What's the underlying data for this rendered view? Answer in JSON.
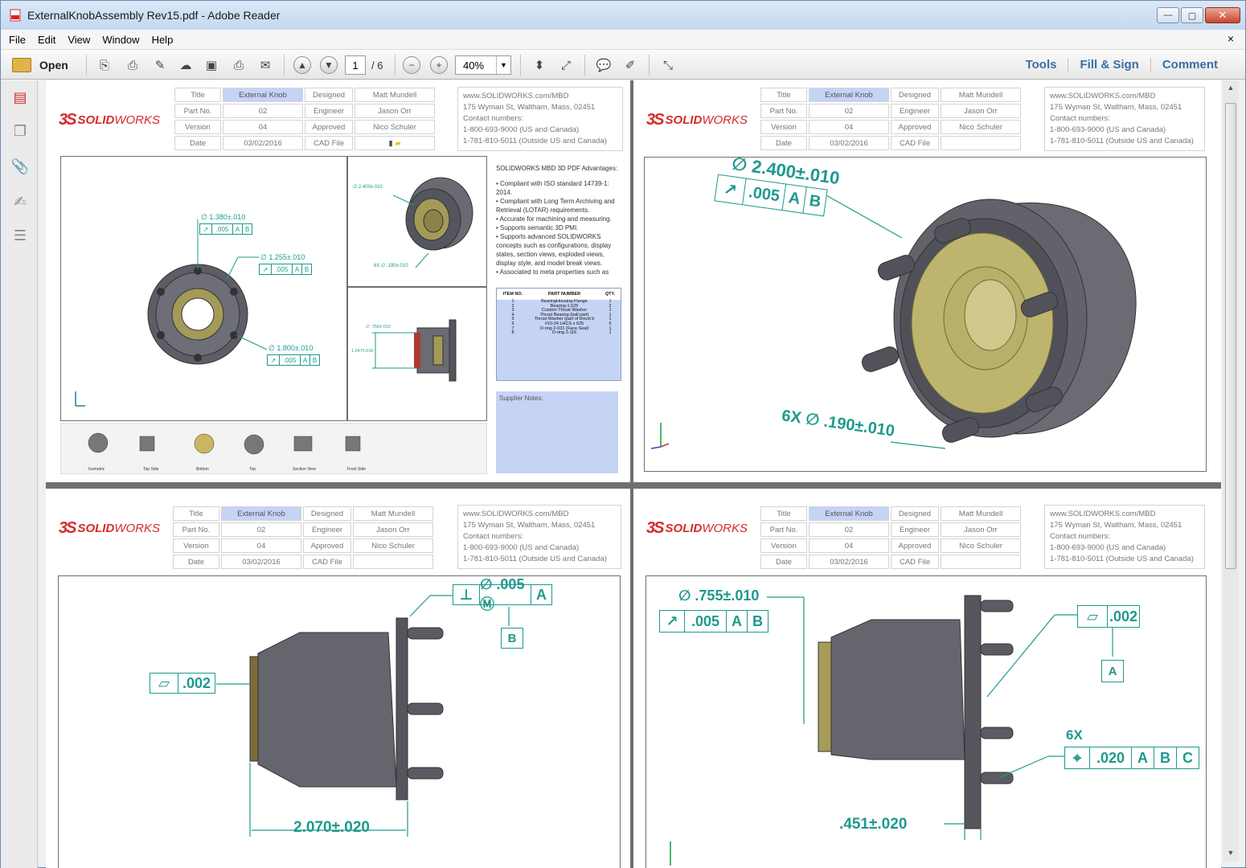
{
  "window": {
    "title": "ExternalKnobAssembly Rev15.pdf - Adobe Reader",
    "controls": {
      "minimize": "—",
      "maximize": "▢",
      "close": "✕"
    }
  },
  "menu": {
    "items": [
      "File",
      "Edit",
      "View",
      "Window",
      "Help"
    ],
    "doc_close": "×"
  },
  "toolbar": {
    "open_label": "Open",
    "current_page": "1",
    "page_total": "/ 6",
    "zoom": "40%",
    "right_links": [
      "Tools",
      "Fill & Sign",
      "Comment"
    ]
  },
  "titleblock": {
    "labels": [
      "Title",
      "Part No.",
      "Version",
      "Date",
      "Designed",
      "Engineer",
      "Approved",
      "CAD File"
    ],
    "title_value": "External Knob",
    "part_no": "02",
    "version": "04",
    "date": "03/02/2016",
    "designed": "Matt Mundell",
    "engineer": "Jason Orr",
    "approved": "Nico Schuler"
  },
  "contact": {
    "lines": [
      "www.SOLIDWORKS.com/MBD",
      "175 Wyman St, Waltham, Mass, 02451",
      "Contact numbers:",
      "1-800-693-9000  (US and Canada)",
      "1-781-810-5011  (Outside US and Canada)"
    ]
  },
  "logo": {
    "ds": "3S",
    "text_solid": "SOLID",
    "text_works": "WORKS"
  },
  "page1": {
    "dims": {
      "d1": "∅ 1.380±.010",
      "d2": "∅ 1.255±.010",
      "d3": "∅ 1.800±.010",
      "fcf": [
        "↗",
        ".005",
        "A",
        "B"
      ],
      "small1": "∅ 2.400±.010",
      "small2": "6X ∅ .190±.010",
      "small3": "∅ .756±.010",
      "small4": "1.247±.010"
    },
    "advantages_title": "SOLIDWORKS MBD 3D PDF Advantages:",
    "advantages": [
      "• Compliant with ISO standard 14739-1: 2014.",
      "• Compliant with Long Term Archiving and Retrieval (LOTAR) requirements.",
      "• Accurate for machining and measuring.",
      "• Supports semantic 3D PMI.",
      "• Supports advanced SOLIDWORKS concepts such as configurations, display states, section views, exploded views, display style, and model break views.",
      "• Associated to meta properties such as"
    ],
    "bom_headers": [
      "ITEM NO.",
      "PART NUMBER",
      "QTY."
    ],
    "bom_rows": [
      [
        "1",
        "BearingHousing-Flange",
        "1"
      ],
      [
        "2",
        "Bearing-1.625",
        "2"
      ],
      [
        "3",
        "Custom Thrust Washer",
        "1"
      ],
      [
        "4",
        "Thrust Bearing (ball part)",
        "1"
      ],
      [
        "5",
        "Thrust Washer (part of thrust b",
        "1"
      ],
      [
        "6",
        "#10-24 LHCS x 625",
        "6"
      ],
      [
        "7",
        "O-ring 2-031 (Face Seal)",
        "1"
      ],
      [
        "8",
        "O-ring 2-116",
        "1"
      ]
    ],
    "supplier_notes": "Supplier Notes:",
    "thumbs": [
      "Isometric",
      "Top Side",
      "Bottom",
      "Top",
      "Section View",
      "Front Side"
    ]
  },
  "page2": {
    "dim_top": "∅ 2.400±.010",
    "fcf": [
      "↗",
      ".005",
      "A",
      "B"
    ],
    "dim_bottom": "6X ∅ .190±.010"
  },
  "page3": {
    "fcf_top": [
      "⊥",
      "∅ .005 Ⓜ",
      "A"
    ],
    "datum_b": "B",
    "fcf_left": [
      "▱",
      ".002"
    ],
    "dim_bottom": "2.070±.020"
  },
  "page4": {
    "dim_top": "∅ .755±.010",
    "fcf_left": [
      "↗",
      ".005",
      "A",
      "B"
    ],
    "fcf_right": [
      "▱",
      ".002"
    ],
    "datum_a": "A",
    "label_6x": "6X",
    "fcf_pos": [
      "⌖",
      ".020",
      "A",
      "B",
      "C"
    ],
    "dim_bottom": ".451±.020"
  },
  "colors": {
    "accent": "#1d9a8e",
    "logo": "#d52b2b",
    "highlight": "#c5d3f5",
    "link": "#3a6ea5"
  }
}
